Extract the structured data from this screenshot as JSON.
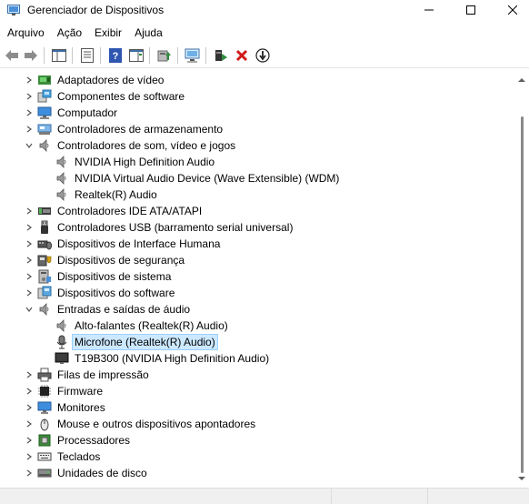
{
  "window": {
    "title": "Gerenciador de Dispositivos",
    "minimize": "—",
    "maximize": "☐",
    "close": "✕"
  },
  "menu": [
    "Arquivo",
    "Ação",
    "Exibir",
    "Ajuda"
  ],
  "toolbar": [
    "back",
    "forward",
    "properties",
    "help",
    "update-driver",
    "scan-hardware",
    "monitor",
    "enable-device",
    "uninstall-device",
    "disable-device"
  ],
  "tree": [
    {
      "label": "Adaptadores de vídeo",
      "level": 1,
      "expanded": false,
      "icon": "display-adapter-icon"
    },
    {
      "label": "Componentes de software",
      "level": 1,
      "expanded": false,
      "icon": "software-component-icon"
    },
    {
      "label": "Computador",
      "level": 1,
      "expanded": false,
      "icon": "computer-icon"
    },
    {
      "label": "Controladores de armazenamento",
      "level": 1,
      "expanded": false,
      "icon": "storage-controller-icon"
    },
    {
      "label": "Controladores de som, vídeo e jogos",
      "level": 1,
      "expanded": true,
      "icon": "speaker-icon"
    },
    {
      "label": "NVIDIA High Definition Audio",
      "level": 2,
      "icon": "speaker-icon"
    },
    {
      "label": "NVIDIA Virtual Audio Device (Wave Extensible) (WDM)",
      "level": 2,
      "icon": "speaker-icon"
    },
    {
      "label": "Realtek(R) Audio",
      "level": 2,
      "icon": "speaker-icon"
    },
    {
      "label": "Controladores IDE ATA/ATAPI",
      "level": 1,
      "expanded": false,
      "icon": "ide-controller-icon"
    },
    {
      "label": "Controladores USB (barramento serial universal)",
      "level": 1,
      "expanded": false,
      "icon": "usb-icon"
    },
    {
      "label": "Dispositivos de Interface Humana",
      "level": 1,
      "expanded": false,
      "icon": "hid-icon"
    },
    {
      "label": "Dispositivos de segurança",
      "level": 1,
      "expanded": false,
      "icon": "security-device-icon"
    },
    {
      "label": "Dispositivos de sistema",
      "level": 1,
      "expanded": false,
      "icon": "system-device-icon"
    },
    {
      "label": "Dispositivos do software",
      "level": 1,
      "expanded": false,
      "icon": "software-device-icon"
    },
    {
      "label": "Entradas e saídas de áudio",
      "level": 1,
      "expanded": true,
      "icon": "speaker-icon"
    },
    {
      "label": "Alto-falantes (Realtek(R) Audio)",
      "level": 2,
      "icon": "speaker-icon"
    },
    {
      "label": "Microfone (Realtek(R) Audio)",
      "level": 2,
      "icon": "microphone-icon",
      "selected": true
    },
    {
      "label": "T19B300 (NVIDIA High Definition Audio)",
      "level": 2,
      "icon": "monitor-audio-icon"
    },
    {
      "label": "Filas de impressão",
      "level": 1,
      "expanded": false,
      "icon": "printer-icon"
    },
    {
      "label": "Firmware",
      "level": 1,
      "expanded": false,
      "icon": "firmware-icon"
    },
    {
      "label": "Monitores",
      "level": 1,
      "expanded": false,
      "icon": "monitor-icon"
    },
    {
      "label": "Mouse e outros dispositivos apontadores",
      "level": 1,
      "expanded": false,
      "icon": "mouse-icon"
    },
    {
      "label": "Processadores",
      "level": 1,
      "expanded": false,
      "icon": "processor-icon"
    },
    {
      "label": "Teclados",
      "level": 1,
      "expanded": false,
      "icon": "keyboard-icon"
    },
    {
      "label": "Unidades de disco",
      "level": 1,
      "expanded": false,
      "icon": "disk-drive-icon"
    }
  ]
}
